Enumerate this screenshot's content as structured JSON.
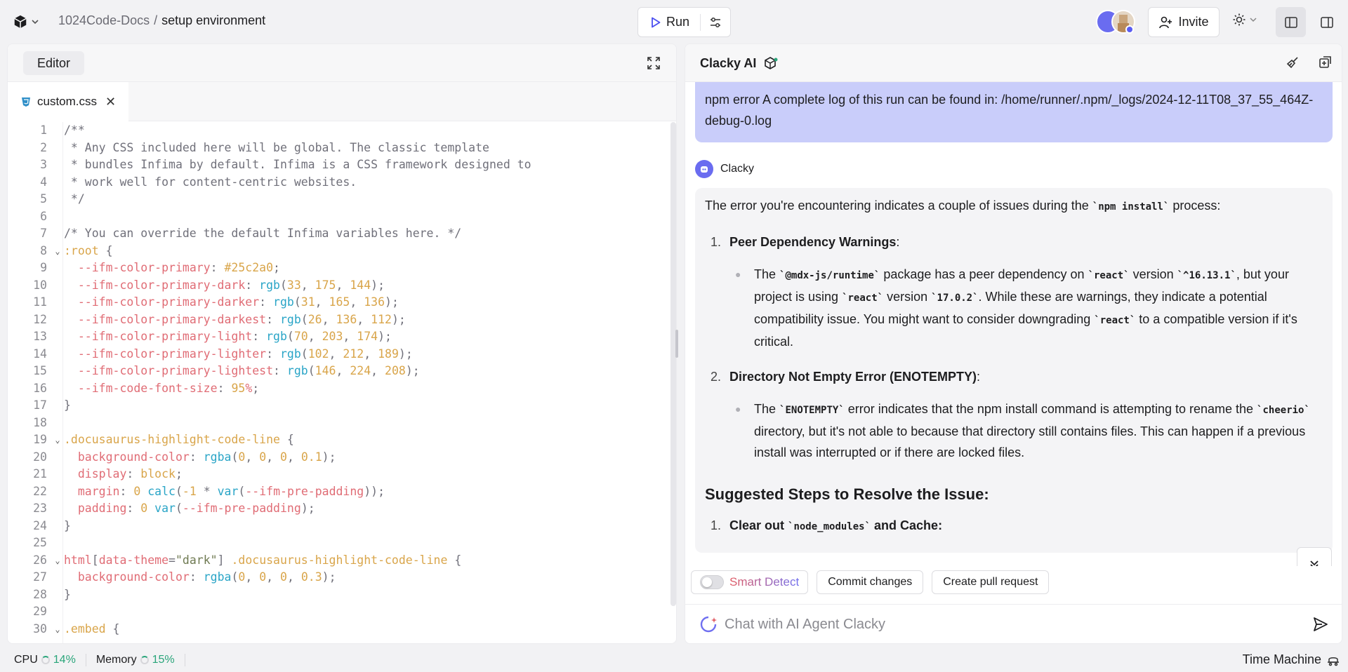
{
  "header": {
    "project": "1024Code-Docs",
    "separator": "/",
    "page": "setup environment",
    "run_label": "Run",
    "invite_label": "Invite"
  },
  "editor": {
    "panel_title": "Editor",
    "file_tab": "custom.css",
    "close_glyph": "✕",
    "lines": [
      {
        "n": "1",
        "fold": "",
        "html": "<span class='c-com'>/**</span>"
      },
      {
        "n": "2",
        "fold": "",
        "html": "<span class='c-com'> * Any CSS included here will be global. The classic template</span>"
      },
      {
        "n": "3",
        "fold": "",
        "html": "<span class='c-com'> * bundles Infima by default. Infima is a CSS framework designed to</span>"
      },
      {
        "n": "4",
        "fold": "",
        "html": "<span class='c-com'> * work well for content-centric websites.</span>"
      },
      {
        "n": "5",
        "fold": "",
        "html": "<span class='c-com'> */</span>"
      },
      {
        "n": "6",
        "fold": "",
        "html": ""
      },
      {
        "n": "7",
        "fold": "",
        "html": "<span class='c-com'>/* You can override the default Infima variables here. */</span>"
      },
      {
        "n": "8",
        "fold": "⌄",
        "html": "<span class='c-sel'>:root</span> <span class='c-pun'>{</span>"
      },
      {
        "n": "9",
        "fold": "",
        "html": "  <span class='c-prop'>--ifm-color-primary</span><span class='c-pun'>:</span> <span class='c-num'>#25c2a0</span><span class='c-pun'>;</span>"
      },
      {
        "n": "10",
        "fold": "",
        "html": "  <span class='c-prop'>--ifm-color-primary-dark</span><span class='c-pun'>:</span> <span class='c-fn'>rgb</span><span class='c-pun'>(</span><span class='c-num'>33</span><span class='c-pun'>, </span><span class='c-num'>175</span><span class='c-pun'>, </span><span class='c-num'>144</span><span class='c-pun'>);</span>"
      },
      {
        "n": "11",
        "fold": "",
        "html": "  <span class='c-prop'>--ifm-color-primary-darker</span><span class='c-pun'>:</span> <span class='c-fn'>rgb</span><span class='c-pun'>(</span><span class='c-num'>31</span><span class='c-pun'>, </span><span class='c-num'>165</span><span class='c-pun'>, </span><span class='c-num'>136</span><span class='c-pun'>);</span>"
      },
      {
        "n": "12",
        "fold": "",
        "html": "  <span class='c-prop'>--ifm-color-primary-darkest</span><span class='c-pun'>:</span> <span class='c-fn'>rgb</span><span class='c-pun'>(</span><span class='c-num'>26</span><span class='c-pun'>, </span><span class='c-num'>136</span><span class='c-pun'>, </span><span class='c-num'>112</span><span class='c-pun'>);</span>"
      },
      {
        "n": "13",
        "fold": "",
        "html": "  <span class='c-prop'>--ifm-color-primary-light</span><span class='c-pun'>:</span> <span class='c-fn'>rgb</span><span class='c-pun'>(</span><span class='c-num'>70</span><span class='c-pun'>, </span><span class='c-num'>203</span><span class='c-pun'>, </span><span class='c-num'>174</span><span class='c-pun'>);</span>"
      },
      {
        "n": "14",
        "fold": "",
        "html": "  <span class='c-prop'>--ifm-color-primary-lighter</span><span class='c-pun'>:</span> <span class='c-fn'>rgb</span><span class='c-pun'>(</span><span class='c-num'>102</span><span class='c-pun'>, </span><span class='c-num'>212</span><span class='c-pun'>, </span><span class='c-num'>189</span><span class='c-pun'>);</span>"
      },
      {
        "n": "15",
        "fold": "",
        "html": "  <span class='c-prop'>--ifm-color-primary-lightest</span><span class='c-pun'>:</span> <span class='c-fn'>rgb</span><span class='c-pun'>(</span><span class='c-num'>146</span><span class='c-pun'>, </span><span class='c-num'>224</span><span class='c-pun'>, </span><span class='c-num'>208</span><span class='c-pun'>);</span>"
      },
      {
        "n": "16",
        "fold": "",
        "html": "  <span class='c-prop'>--ifm-code-font-size</span><span class='c-pun'>:</span> <span class='c-num'>95</span><span class='c-prop'>%</span><span class='c-pun'>;</span>"
      },
      {
        "n": "17",
        "fold": "",
        "html": "<span class='c-pun'>}</span>"
      },
      {
        "n": "18",
        "fold": "",
        "html": ""
      },
      {
        "n": "19",
        "fold": "⌄",
        "html": "<span class='c-sel'>.docusaurus-highlight-code-line</span> <span class='c-pun'>{</span>"
      },
      {
        "n": "20",
        "fold": "",
        "html": "  <span class='c-prop'>background-color</span><span class='c-pun'>:</span> <span class='c-fn'>rgba</span><span class='c-pun'>(</span><span class='c-num'>0</span><span class='c-pun'>, </span><span class='c-num'>0</span><span class='c-pun'>, </span><span class='c-num'>0</span><span class='c-pun'>, </span><span class='c-num'>0.1</span><span class='c-pun'>);</span>"
      },
      {
        "n": "21",
        "fold": "",
        "html": "  <span class='c-prop'>display</span><span class='c-pun'>:</span> <span class='c-num'>block</span><span class='c-pun'>;</span>"
      },
      {
        "n": "22",
        "fold": "",
        "html": "  <span class='c-prop'>margin</span><span class='c-pun'>:</span> <span class='c-num'>0</span> <span class='c-fn'>calc</span><span class='c-pun'>(</span><span class='c-num'>-1</span> <span class='c-pun'>*</span> <span class='c-fn'>var</span><span class='c-pun'>(</span><span class='c-prop'>--ifm-pre-padding</span><span class='c-pun'>));</span>"
      },
      {
        "n": "23",
        "fold": "",
        "html": "  <span class='c-prop'>padding</span><span class='c-pun'>:</span> <span class='c-num'>0</span> <span class='c-fn'>var</span><span class='c-pun'>(</span><span class='c-prop'>--ifm-pre-padding</span><span class='c-pun'>);</span>"
      },
      {
        "n": "24",
        "fold": "",
        "html": "<span class='c-pun'>}</span>"
      },
      {
        "n": "25",
        "fold": "",
        "html": ""
      },
      {
        "n": "26",
        "fold": "⌄",
        "html": "<span class='c-prop'>html</span><span class='c-pun'>[</span><span class='c-prop'>data-theme</span><span class='c-pun'>=</span><span class='c-str'>\"dark\"</span><span class='c-pun'>]</span> <span class='c-sel'>.docusaurus-highlight-code-line</span> <span class='c-pun'>{</span>"
      },
      {
        "n": "27",
        "fold": "",
        "html": "  <span class='c-prop'>background-color</span><span class='c-pun'>:</span> <span class='c-fn'>rgba</span><span class='c-pun'>(</span><span class='c-num'>0</span><span class='c-pun'>, </span><span class='c-num'>0</span><span class='c-pun'>, </span><span class='c-num'>0</span><span class='c-pun'>, </span><span class='c-num'>0.3</span><span class='c-pun'>);</span>"
      },
      {
        "n": "28",
        "fold": "",
        "html": "<span class='c-pun'>}</span>"
      },
      {
        "n": "29",
        "fold": "",
        "html": ""
      },
      {
        "n": "30",
        "fold": "⌄",
        "html": "<span class='c-sel'>.embed</span> <span class='c-pun'>{</span>"
      }
    ]
  },
  "chat": {
    "title": "Clacky AI",
    "user_message": "npm error A complete log of this run can be found in: /home/runner/.npm/_logs/2024-12-11T08_37_55_464Z-debug-0.log",
    "bot_name": "Clacky",
    "intro_pre": "The error you're encountering indicates a couple of issues during the ",
    "intro_code": "`npm install`",
    "intro_post": " process:",
    "item1_num": "1.",
    "item1_title": "Peer Dependency Warnings",
    "item1_colon": ":",
    "item1_b1": "The ",
    "item1_c1": "`@mdx-js/runtime`",
    "item1_b2": " package has a peer dependency on ",
    "item1_c2": "`react`",
    "item1_b3": " version ",
    "item1_c3": "`^16.13.1`",
    "item1_b4": ", but your project is using ",
    "item1_c4": "`react`",
    "item1_b5": " version ",
    "item1_c5": "`17.0.2`",
    "item1_b6": ". While these are warnings, they indicate a potential compatibility issue. You might want to consider downgrading ",
    "item1_c6": "`react`",
    "item1_b7": " to a compatible version if it's critical.",
    "item2_num": "2.",
    "item2_title": "Directory Not Empty Error (ENOTEMPTY)",
    "item2_colon": ":",
    "item2_b1": "The ",
    "item2_c1": "`ENOTEMPTY`",
    "item2_b2": " error indicates that the npm install command is attempting to rename the ",
    "item2_c2": "`cheerio`",
    "item2_b3": " directory, but it's not able to because that directory still contains files. This can happen if a previous install was interrupted or if there are locked files.",
    "heading": "Suggested Steps to Resolve the Issue:",
    "step1_num": "1.",
    "step1_pre": "Clear out ",
    "step1_code": "`node_modules`",
    "step1_post": " and Cache",
    "step1_colon": ":",
    "smart_detect": "Smart Detect",
    "commit_label": "Commit changes",
    "pr_label": "Create pull request",
    "input_placeholder": "Chat with AI Agent Clacky"
  },
  "status": {
    "cpu_label": "CPU",
    "cpu_value": "14%",
    "mem_label": "Memory",
    "mem_value": "15%",
    "time_machine": "Time Machine"
  }
}
